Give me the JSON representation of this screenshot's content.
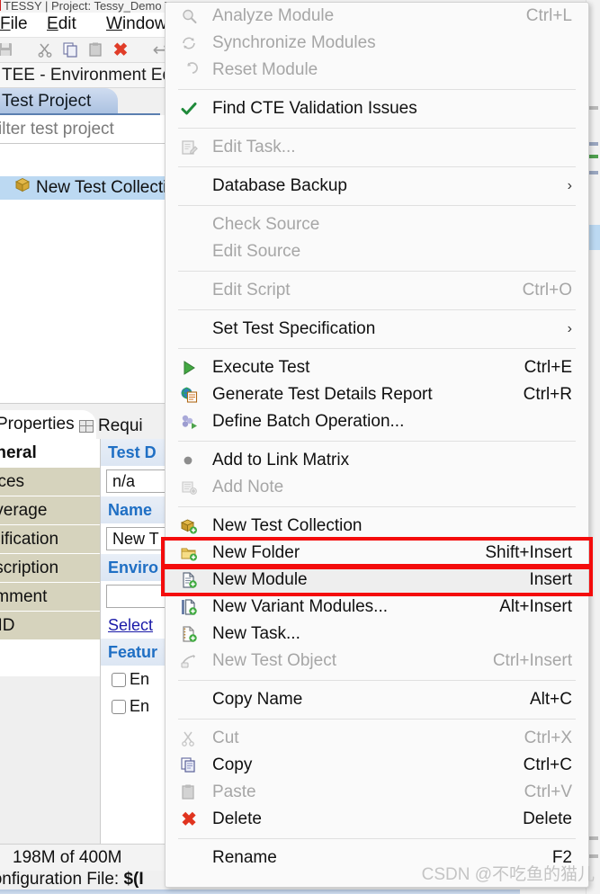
{
  "window": {
    "title": "TESSY | Project: Tessy_Demo  Test C",
    "menubar": [
      {
        "label": "File",
        "mnemonic": "F"
      },
      {
        "label": "Edit",
        "mnemonic": "E"
      },
      {
        "label": "Window",
        "mnemonic": "W"
      }
    ],
    "toolbar_icons": [
      "save-icon",
      "cut-icon",
      "copy-icon",
      "paste-icon",
      "delete-icon",
      "undo-icon",
      "redo-icon"
    ],
    "view_title": "TEE - Environment Ed",
    "tabs": [
      {
        "label": "Test Project",
        "active": true
      }
    ],
    "filter_placeholder": "ilter test project",
    "tree": [
      {
        "label": "New Test Collectio",
        "icon": "test-collection-icon",
        "selected": true
      }
    ]
  },
  "properties": {
    "tabs": [
      {
        "label": "Properties",
        "active": true,
        "icon": ""
      },
      {
        "label": "Requi",
        "active": false,
        "icon": "grid-icon"
      }
    ],
    "sections": [
      {
        "label": "General",
        "selected": true
      },
      {
        "label": "ources",
        "selected": false
      },
      {
        "label": "Coverage",
        "selected": false
      },
      {
        "label": "pecification",
        "selected": false
      },
      {
        "label": "Description",
        "selected": false
      },
      {
        "label": "Comment",
        "selected": false
      },
      {
        "label": "UUID",
        "selected": false
      }
    ],
    "fields": [
      {
        "kind": "head",
        "label": "Test D"
      },
      {
        "kind": "input",
        "value": "n/a"
      },
      {
        "kind": "head",
        "label": "Name"
      },
      {
        "kind": "input",
        "value": "New T"
      },
      {
        "kind": "head",
        "label": "Enviro"
      },
      {
        "kind": "input",
        "value": ""
      },
      {
        "kind": "link",
        "label": "Select"
      },
      {
        "kind": "head",
        "label": "Featur"
      },
      {
        "kind": "check",
        "label": "En",
        "checked": false
      },
      {
        "kind": "check",
        "label": "En",
        "checked": false
      }
    ]
  },
  "status": {
    "memory": "198M of 400M",
    "config_label": "Configuration File: ",
    "config_value": "$(I"
  },
  "context_menu": {
    "items": [
      {
        "type": "item",
        "label": "Analyze Module",
        "accel": "Ctrl+L",
        "icon": "analyze-icon",
        "disabled": true
      },
      {
        "type": "item",
        "label": "Synchronize Modules",
        "accel": "",
        "icon": "sync-icon",
        "disabled": true
      },
      {
        "type": "item",
        "label": "Reset Module",
        "accel": "",
        "icon": "reset-icon",
        "disabled": true
      },
      {
        "type": "sep"
      },
      {
        "type": "item",
        "label": "Find CTE Validation Issues",
        "accel": "",
        "icon": "check-mark-icon",
        "disabled": false
      },
      {
        "type": "sep"
      },
      {
        "type": "item",
        "label": "Edit Task...",
        "accel": "",
        "icon": "edit-task-icon",
        "disabled": true
      },
      {
        "type": "sep"
      },
      {
        "type": "item",
        "label": "Database Backup",
        "accel": "",
        "icon": "",
        "disabled": false,
        "submenu": true
      },
      {
        "type": "sep"
      },
      {
        "type": "item",
        "label": "Check Source",
        "accel": "",
        "icon": "",
        "disabled": true
      },
      {
        "type": "item",
        "label": "Edit Source",
        "accel": "",
        "icon": "",
        "disabled": true
      },
      {
        "type": "sep"
      },
      {
        "type": "item",
        "label": "Edit Script",
        "accel": "Ctrl+O",
        "icon": "",
        "disabled": true
      },
      {
        "type": "sep"
      },
      {
        "type": "item",
        "label": "Set Test Specification",
        "accel": "",
        "icon": "",
        "disabled": false,
        "submenu": true
      },
      {
        "type": "sep"
      },
      {
        "type": "item",
        "label": "Execute Test",
        "accel": "Ctrl+E",
        "icon": "play-icon",
        "disabled": false
      },
      {
        "type": "item",
        "label": "Generate Test Details Report",
        "accel": "Ctrl+R",
        "icon": "report-icon",
        "disabled": false
      },
      {
        "type": "item",
        "label": "Define Batch Operation...",
        "accel": "",
        "icon": "batch-icon",
        "disabled": false
      },
      {
        "type": "sep"
      },
      {
        "type": "item",
        "label": "Add to Link Matrix",
        "accel": "",
        "icon": "dot-icon",
        "disabled": false
      },
      {
        "type": "item",
        "label": "Add Note",
        "accel": "",
        "icon": "note-icon",
        "disabled": true
      },
      {
        "type": "sep"
      },
      {
        "type": "item",
        "label": "New Test Collection",
        "accel": "",
        "icon": "new-test-collection-icon",
        "disabled": false
      },
      {
        "type": "item",
        "label": "New Folder",
        "accel": "Shift+Insert",
        "icon": "new-folder-icon",
        "disabled": false,
        "highlight_box": true
      },
      {
        "type": "item",
        "label": "New Module",
        "accel": "Insert",
        "icon": "new-module-icon",
        "disabled": false,
        "highlight_box": true,
        "hovered": true
      },
      {
        "type": "item",
        "label": "New Variant Modules...",
        "accel": "Alt+Insert",
        "icon": "new-variant-icon",
        "disabled": false
      },
      {
        "type": "item",
        "label": "New Task...",
        "accel": "",
        "icon": "new-task-icon",
        "disabled": false
      },
      {
        "type": "item",
        "label": "New Test Object",
        "accel": "Ctrl+Insert",
        "icon": "new-test-object-icon",
        "disabled": true
      },
      {
        "type": "sep"
      },
      {
        "type": "item",
        "label": "Copy Name",
        "accel": "Alt+C",
        "icon": "",
        "disabled": false
      },
      {
        "type": "sep"
      },
      {
        "type": "item",
        "label": "Cut",
        "accel": "Ctrl+X",
        "icon": "cut-icon",
        "disabled": true
      },
      {
        "type": "item",
        "label": "Copy",
        "accel": "Ctrl+C",
        "icon": "copy-icon",
        "disabled": false
      },
      {
        "type": "item",
        "label": "Paste",
        "accel": "Ctrl+V",
        "icon": "paste-icon",
        "disabled": true
      },
      {
        "type": "item",
        "label": "Delete",
        "accel": "Delete",
        "icon": "delete-icon",
        "disabled": false
      },
      {
        "type": "sep"
      },
      {
        "type": "item",
        "label": "Rename",
        "accel": "F2",
        "icon": "",
        "disabled": false
      }
    ]
  },
  "watermark": "CSDN @不吃鱼的猫儿",
  "colors": {
    "accent_red": "#f40c0c",
    "selection_blue": "#bcd9f2",
    "header_blue": "#1f6fc4",
    "menu_bg": "#fafafa",
    "hover_bg": "#eeeeee"
  }
}
